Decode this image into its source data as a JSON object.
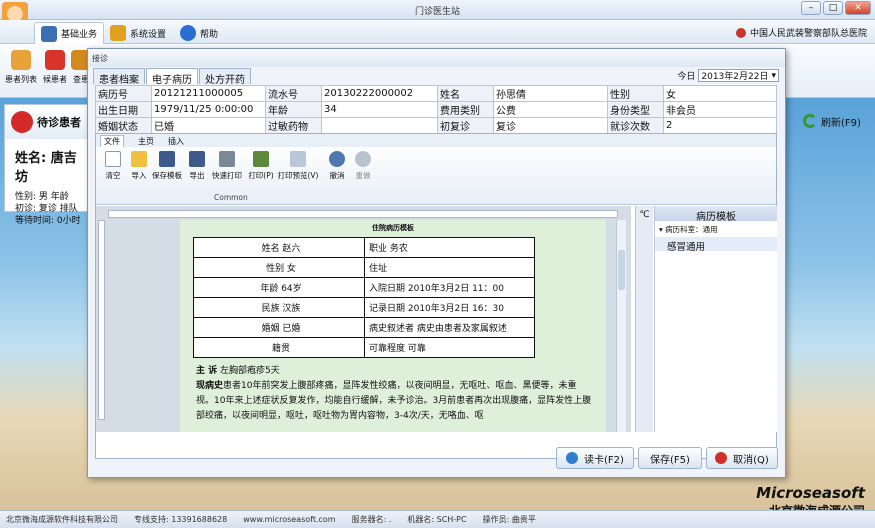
{
  "app": {
    "title": "门诊医生站",
    "org": "中国人民武装警察部队总医院",
    "menu": [
      {
        "label": "基础业务"
      },
      {
        "label": "系统设置"
      },
      {
        "label": "帮助"
      }
    ],
    "ribbon": [
      {
        "label": "患者列表"
      },
      {
        "label": "候患者"
      },
      {
        "label": "查患"
      }
    ],
    "wait_panel": {
      "title": "待诊患者",
      "name_line": "姓名: 唐吉坊",
      "gender_line": "性别: 男      年龄",
      "visit_line": "初诊: 复诊    排队",
      "wait_line": "等待时间: 0小时"
    },
    "refresh_label": "刷新(F9)",
    "status": [
      "北京微海成源软件科技有限公司",
      "专线支持: 13391688628",
      "www.microseasoft.com",
      "服务器名: .",
      "机器名: SCH-PC",
      "操作员: 曲贵平"
    ],
    "brand": {
      "en": "Microseasoft",
      "zh": "北京微海成源公司"
    }
  },
  "dialog": {
    "title": "接诊",
    "tabs": [
      "患者档案",
      "电子病历",
      "处方开药"
    ],
    "today_label": "今日",
    "today_value": "2013年2月22日",
    "info_rows": [
      [
        "病历号",
        "20121211000005",
        "流水号",
        "20130222000002",
        "姓名",
        "孙思倩",
        "性别",
        "女"
      ],
      [
        "出生日期",
        "1979/11/25 0:00:00",
        "年龄",
        "34",
        "费用类别",
        "公费",
        "身份类型",
        "非会员"
      ],
      [
        "婚姻状态",
        "已婚",
        "过敏药物",
        "",
        "初复诊",
        "复诊",
        "就诊次数",
        "2"
      ]
    ],
    "editor": {
      "tabs": [
        "文件",
        "主页",
        "插入"
      ],
      "tools": [
        {
          "label": "清空",
          "icon": "clear-icon"
        },
        {
          "label": "导入",
          "icon": "folder-open-icon"
        },
        {
          "label": "保存模板",
          "icon": "save-icon"
        },
        {
          "label": "导出",
          "icon": "export-icon"
        },
        {
          "label": "快速打印",
          "icon": "print-icon"
        },
        {
          "label": "打印(P)",
          "icon": "print-setup-icon"
        },
        {
          "label": "打印预览(V)",
          "icon": "print-preview-icon"
        },
        {
          "label": "撤消",
          "icon": "undo-icon"
        },
        {
          "label": "重做",
          "icon": "redo-icon"
        }
      ],
      "group_label": "Common"
    },
    "document": {
      "title": "住院病历模板",
      "rows": [
        [
          "姓名  赵六",
          "职业 务农"
        ],
        [
          "性别  女",
          "住址"
        ],
        [
          "年龄  64岁",
          "入院日期 2010年3月2日 11：00"
        ],
        [
          "民族  汉族",
          "记录日期 2010年3月2日 16：30"
        ],
        [
          "婚姻  已婚",
          "病史叙述者  病史由患者及家属叙述"
        ],
        [
          "籍贯",
          "可靠程度   可靠"
        ]
      ],
      "chief_label": "主  诉",
      "chief_text": "左胸部疱疹5天",
      "history_label": "现病史",
      "history_text": "患者10年前突发上腹部疼痛，显阵发性绞痛，以夜间明显，无呕吐、呕血、黑便等，未重视。10年来上述症状反复发作，均能自行缓解，未予诊治。3月前患者再次出现腹痛，显阵发性上腹部绞痛，以夜间明显，呕吐，呕吐物为胃内容物，3-4次/天，无咯血、呕"
    },
    "template_panel": {
      "side_label": "℃",
      "title": "病历模板",
      "group": "病历科室：通用",
      "items": [
        "感冒通用"
      ]
    },
    "buttons": {
      "read_card": "读卡(F2)",
      "save": "保存(F5)",
      "cancel": "取消(Q)"
    }
  },
  "colors": {
    "accent": "#3a6ea5",
    "page_bg": "#dff0da",
    "cancel_icon": "#d0302a",
    "read_icon": "#2f7fd0"
  }
}
